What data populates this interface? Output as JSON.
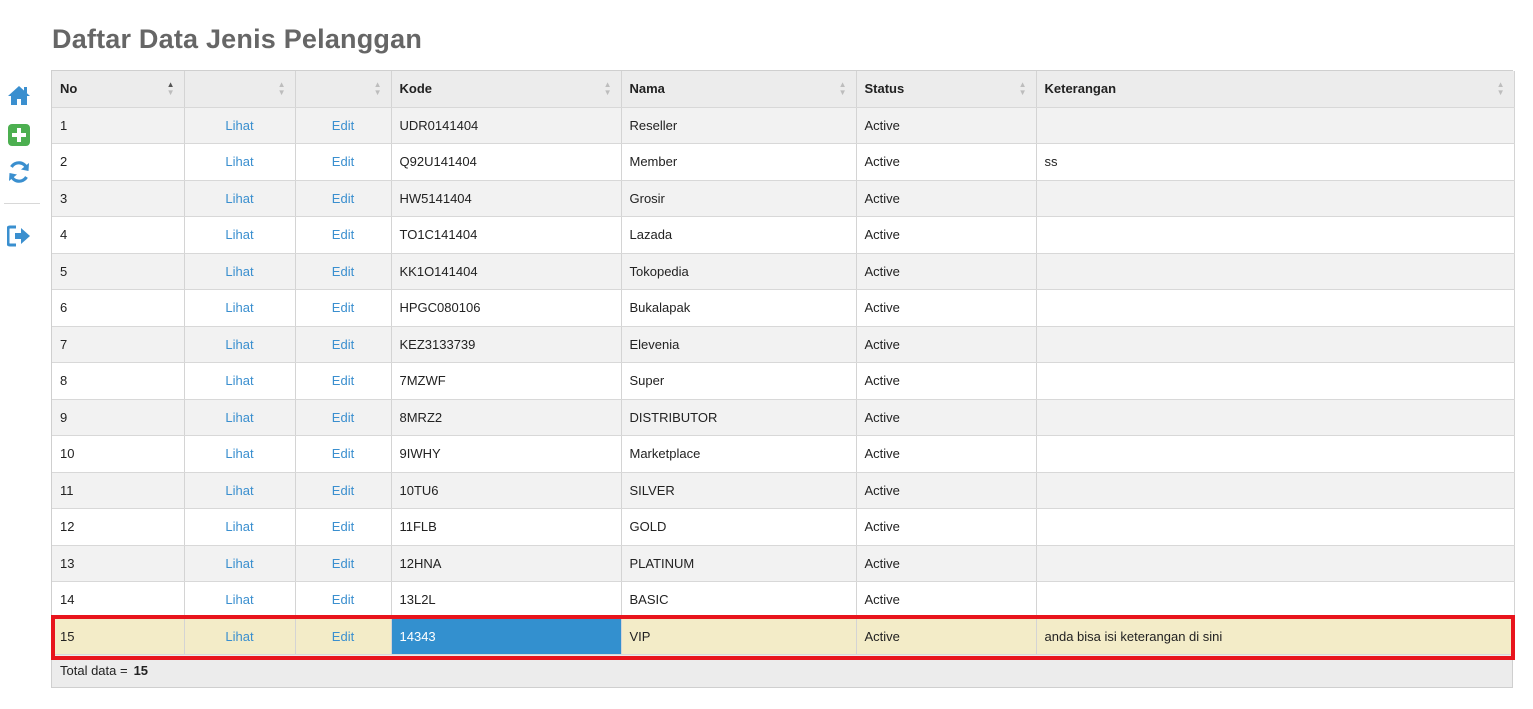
{
  "page": {
    "title": "Daftar Data Jenis Pelanggan"
  },
  "sidebar": {
    "items": [
      {
        "name": "home-icon",
        "color": "#3a8fcf"
      },
      {
        "name": "add-icon",
        "color": "#4caf50"
      },
      {
        "name": "refresh-icon",
        "color": "#3a8fcf"
      },
      {
        "name": "logout-icon",
        "color": "#3a8fcf"
      }
    ]
  },
  "table": {
    "columns": [
      "No",
      "",
      "",
      "Kode",
      "Nama",
      "Status",
      "Keterangan"
    ],
    "sorted_column": "No",
    "sort_direction": "asc",
    "view_label": "Lihat",
    "edit_label": "Edit",
    "rows": [
      {
        "no": "1",
        "kode": "UDR0141404",
        "nama": "Reseller",
        "status": "Active",
        "keterangan": ""
      },
      {
        "no": "2",
        "kode": "Q92U141404",
        "nama": "Member",
        "status": "Active",
        "keterangan": "ss"
      },
      {
        "no": "3",
        "kode": "HW5141404",
        "nama": "Grosir",
        "status": "Active",
        "keterangan": ""
      },
      {
        "no": "4",
        "kode": "TO1C141404",
        "nama": "Lazada",
        "status": "Active",
        "keterangan": ""
      },
      {
        "no": "5",
        "kode": "KK1O141404",
        "nama": "Tokopedia",
        "status": "Active",
        "keterangan": ""
      },
      {
        "no": "6",
        "kode": "HPGC080106",
        "nama": "Bukalapak",
        "status": "Active",
        "keterangan": ""
      },
      {
        "no": "7",
        "kode": "KEZ3133739",
        "nama": "Elevenia",
        "status": "Active",
        "keterangan": ""
      },
      {
        "no": "8",
        "kode": "7MZWF",
        "nama": "Super",
        "status": "Active",
        "keterangan": ""
      },
      {
        "no": "9",
        "kode": "8MRZ2",
        "nama": "DISTRIBUTOR",
        "status": "Active",
        "keterangan": ""
      },
      {
        "no": "10",
        "kode": "9IWHY",
        "nama": "Marketplace",
        "status": "Active",
        "keterangan": ""
      },
      {
        "no": "11",
        "kode": "10TU6",
        "nama": "SILVER",
        "status": "Active",
        "keterangan": ""
      },
      {
        "no": "12",
        "kode": "11FLB",
        "nama": "GOLD",
        "status": "Active",
        "keterangan": ""
      },
      {
        "no": "13",
        "kode": "12HNA",
        "nama": "PLATINUM",
        "status": "Active",
        "keterangan": ""
      },
      {
        "no": "14",
        "kode": "13L2L",
        "nama": "BASIC",
        "status": "Active",
        "keterangan": ""
      },
      {
        "no": "15",
        "kode": "14343",
        "nama": "VIP",
        "status": "Active",
        "keterangan": "anda bisa isi keterangan di sini",
        "selected": true
      }
    ],
    "selected_row_color": "#f3ecc8",
    "active_cell_color": "#3390cf",
    "highlight_border_color": "#e8141c"
  },
  "footer": {
    "label": "Total data =",
    "total": "15"
  }
}
